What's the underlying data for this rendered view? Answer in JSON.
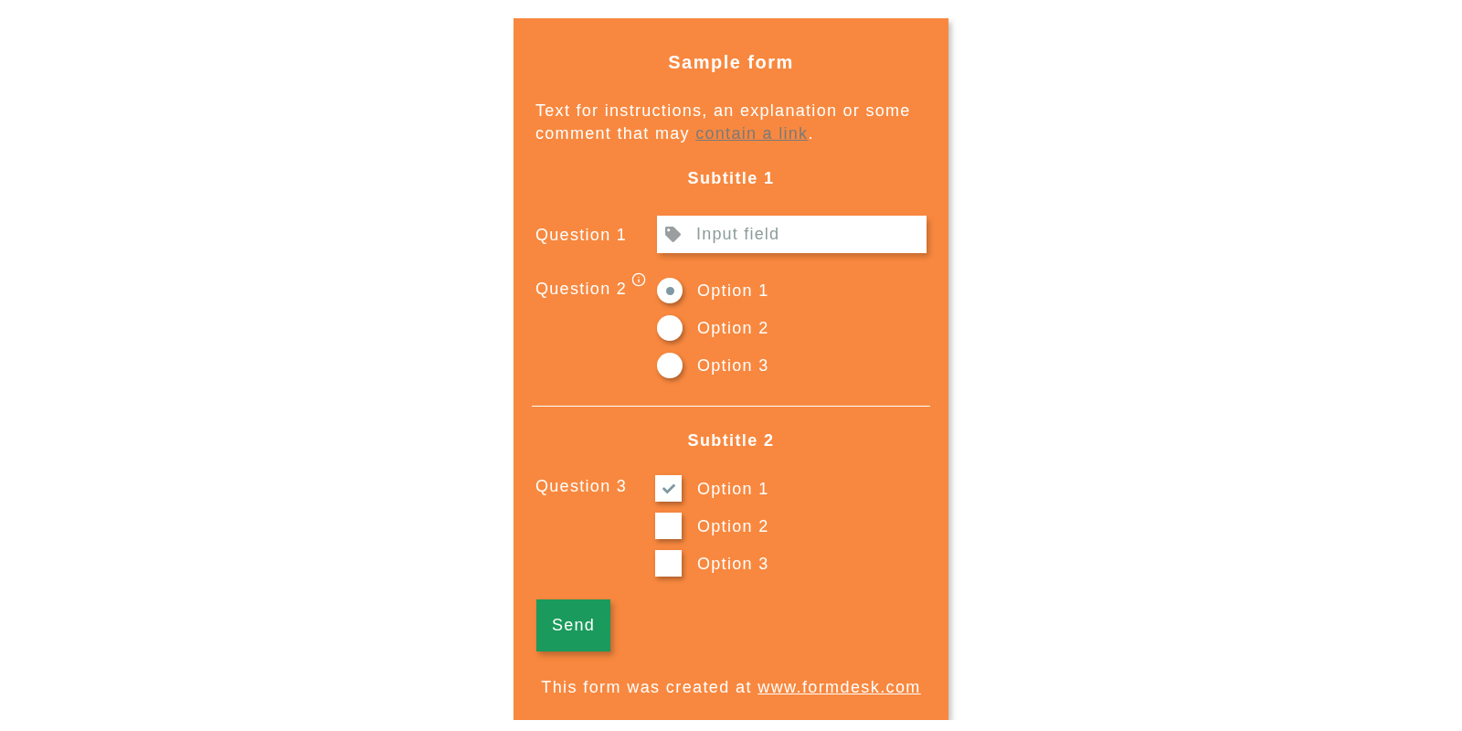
{
  "form": {
    "title": "Sample form",
    "instructions": {
      "text_before": "Text for instructions, an explanation or some comment that may ",
      "link": "contain a link",
      "text_after": "."
    }
  },
  "sections": [
    {
      "subtitle": "Subtitle 1",
      "questions": [
        {
          "kind": "text",
          "label": "Question 1",
          "placeholder": "Input field"
        },
        {
          "kind": "radio",
          "label": "Question 2",
          "info": true,
          "options": [
            {
              "label": "Option 1",
              "selected": true
            },
            {
              "label": "Option 2",
              "selected": false
            },
            {
              "label": "Option 3",
              "selected": false
            }
          ]
        }
      ]
    },
    {
      "subtitle": "Subtitle 2",
      "questions": [
        {
          "kind": "checkbox",
          "label": "Question 3",
          "options": [
            {
              "label": "Option 1",
              "checked": true
            },
            {
              "label": "Option 2",
              "checked": false
            },
            {
              "label": "Option 3",
              "checked": false
            }
          ]
        }
      ]
    }
  ],
  "submit_button": "Send",
  "footer": {
    "text": "This form was created at ",
    "link": "www.formdesk.com"
  }
}
